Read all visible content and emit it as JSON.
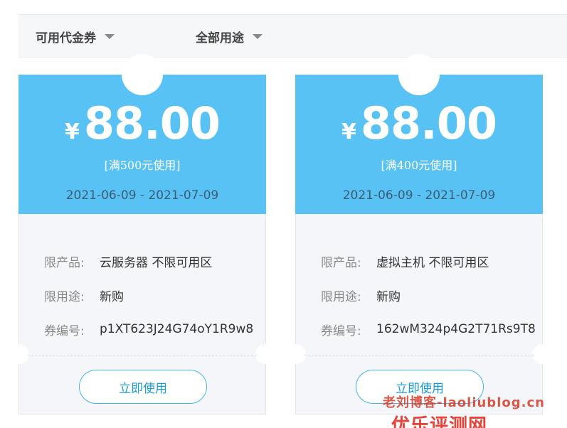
{
  "filters": {
    "voucher_type": "可用代金券",
    "usage": "全部用途"
  },
  "coupons": [
    {
      "currency": "¥",
      "amount": "88.00",
      "condition": "[满500元使用]",
      "date_range": "2021-06-09 - 2021-07-09",
      "product_label": "限产品:",
      "product_value": "云服务器 不限可用区",
      "usage_label": "限用途:",
      "usage_value": "新购",
      "code_label": "券编号:",
      "code_value": "p1XT623J24G74oY1R9w8",
      "button": "立即使用"
    },
    {
      "currency": "¥",
      "amount": "88.00",
      "condition": "[满400元使用]",
      "date_range": "2021-06-09 - 2021-07-09",
      "product_label": "限产品:",
      "product_value": "虚拟主机 不限可用区",
      "usage_label": "限用途:",
      "usage_value": "新购",
      "code_label": "券编号:",
      "code_value": "162wM324p4G2T71Rs9T8",
      "button": "立即使用"
    }
  ],
  "watermark": {
    "text": "老刘博客-laoliublog.cn",
    "brand": "优乐评测网"
  },
  "colors": {
    "coupon_top": "#59c2f4",
    "button_border": "#45b4ea",
    "button_text": "#1a9ad8"
  }
}
